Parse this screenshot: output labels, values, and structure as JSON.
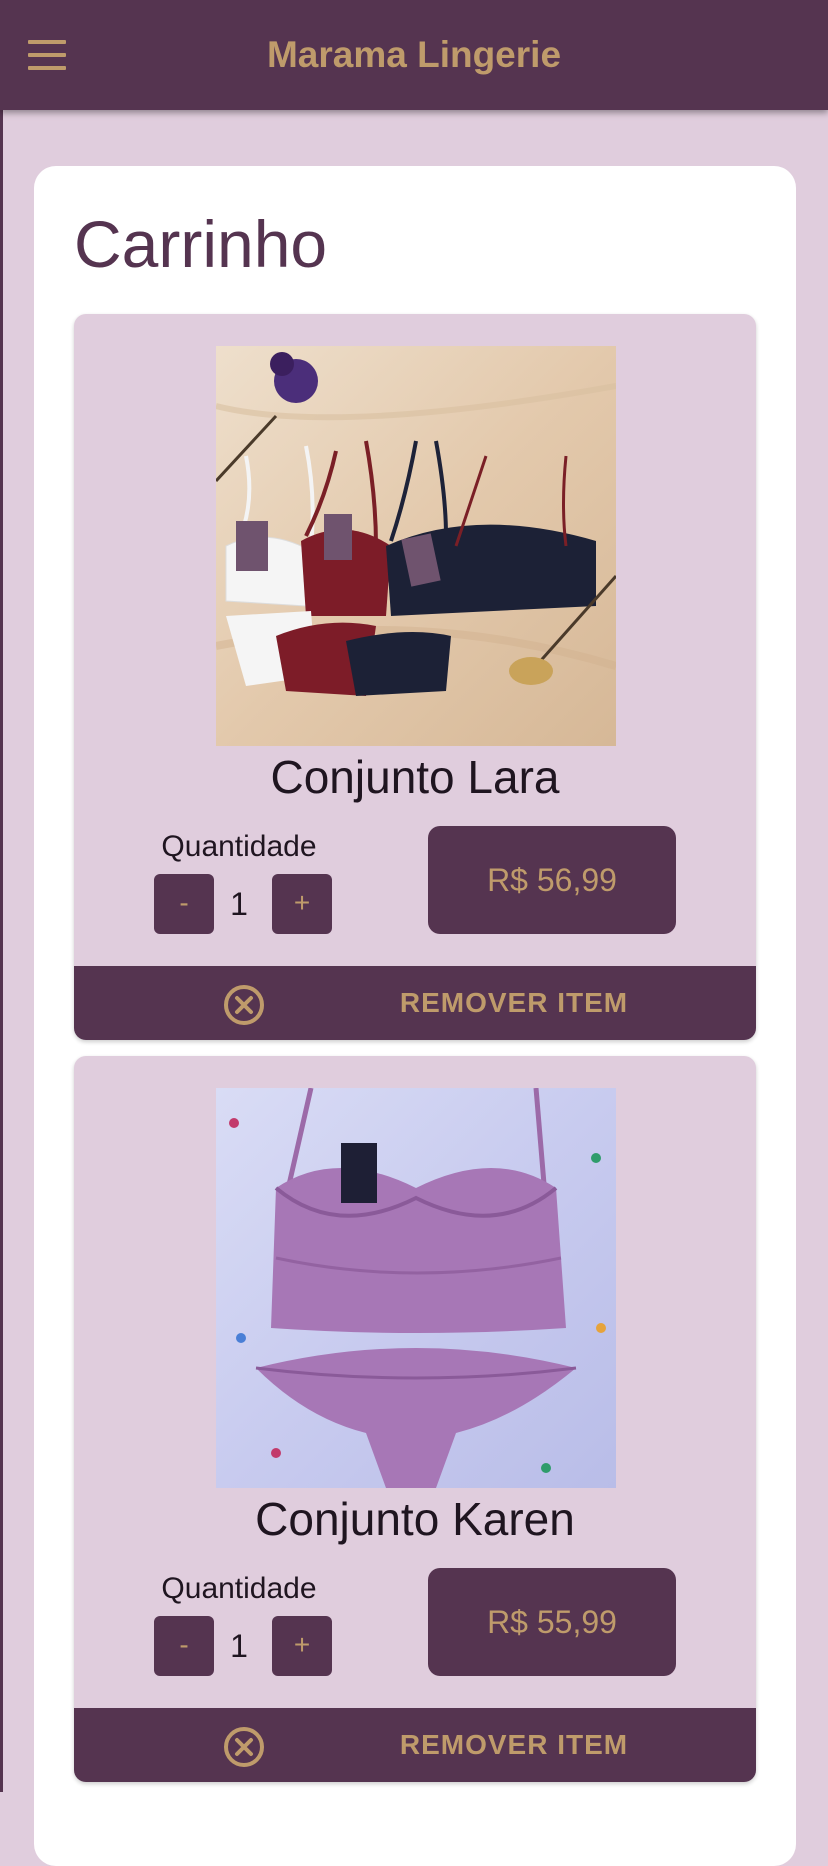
{
  "header": {
    "title": "Marama Lingerie",
    "menu_icon": "hamburger-menu-icon"
  },
  "page": {
    "title": "Carrinho"
  },
  "cart": {
    "items": [
      {
        "name": "Conjunto Lara",
        "quantity_label": "Quantidade",
        "decrement_label": "-",
        "quantity": "1",
        "increment_label": "+",
        "price": "R$ 56,99",
        "remove_label": "REMOVER ITEM",
        "remove_icon": "close-circle-icon"
      },
      {
        "name": "Conjunto Karen",
        "quantity_label": "Quantidade",
        "decrement_label": "-",
        "quantity": "1",
        "increment_label": "+",
        "price": "R$ 55,99",
        "remove_label": "REMOVER ITEM",
        "remove_icon": "close-circle-icon"
      }
    ]
  },
  "colors": {
    "primary": "#553450",
    "accent": "#bf9b6b",
    "background": "#e0cddd",
    "card": "#ffffff"
  }
}
